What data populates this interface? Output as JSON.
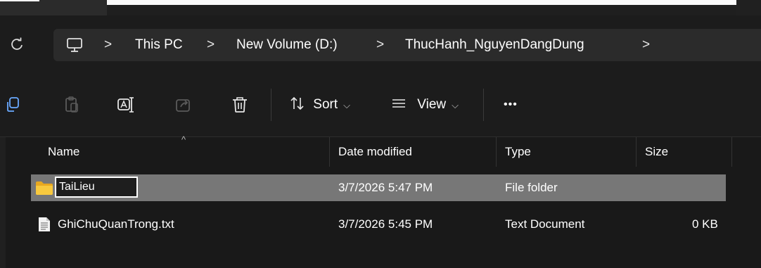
{
  "address_bar": {
    "crumbs": [
      "This PC",
      "New Volume (D:)",
      "ThucHanh_NguyenDangDung"
    ],
    "separator": ">"
  },
  "toolbar": {
    "sort_label": "Sort",
    "view_label": "View",
    "more_label": "•••"
  },
  "columns": {
    "name": "Name",
    "date_modified": "Date modified",
    "type": "Type",
    "size": "Size"
  },
  "files": [
    {
      "name": "TaiLieu",
      "date_modified": "3/7/2026 5:47 PM",
      "type": "File folder",
      "size": "",
      "icon": "folder-icon",
      "selected": true,
      "renaming": true
    },
    {
      "name": "GhiChuQuanTrong.txt",
      "date_modified": "3/7/2026 5:45 PM",
      "type": "Text Document",
      "size": "0 KB",
      "icon": "text-file-icon",
      "selected": false,
      "renaming": false
    }
  ],
  "colors": {
    "selection": "#777777",
    "folder": "#f2c037",
    "background": "#191919"
  }
}
